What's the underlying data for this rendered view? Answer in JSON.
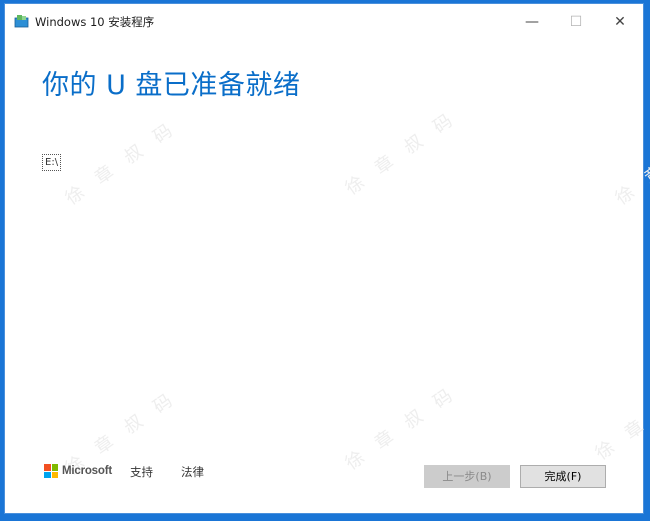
{
  "window": {
    "title": "Windows 10 安装程序",
    "minimize_glyph": "—",
    "maximize_glyph": "☐",
    "close_glyph": "✕"
  },
  "main": {
    "heading": "你的 U 盘已准备就绪",
    "drive_label": "E:\\"
  },
  "watermark": {
    "text": "徐 章 叔 码"
  },
  "footer": {
    "brand": "Microsoft",
    "support_link": "支持",
    "legal_link": "法律",
    "back_button": "上一步(B)",
    "finish_button": "完成(F)"
  },
  "colors": {
    "accent": "#0a6ec9",
    "desktop": "#1a75d6",
    "ms_red": "#f25022",
    "ms_green": "#7fba00",
    "ms_blue": "#00a4ef",
    "ms_yellow": "#ffb900"
  }
}
